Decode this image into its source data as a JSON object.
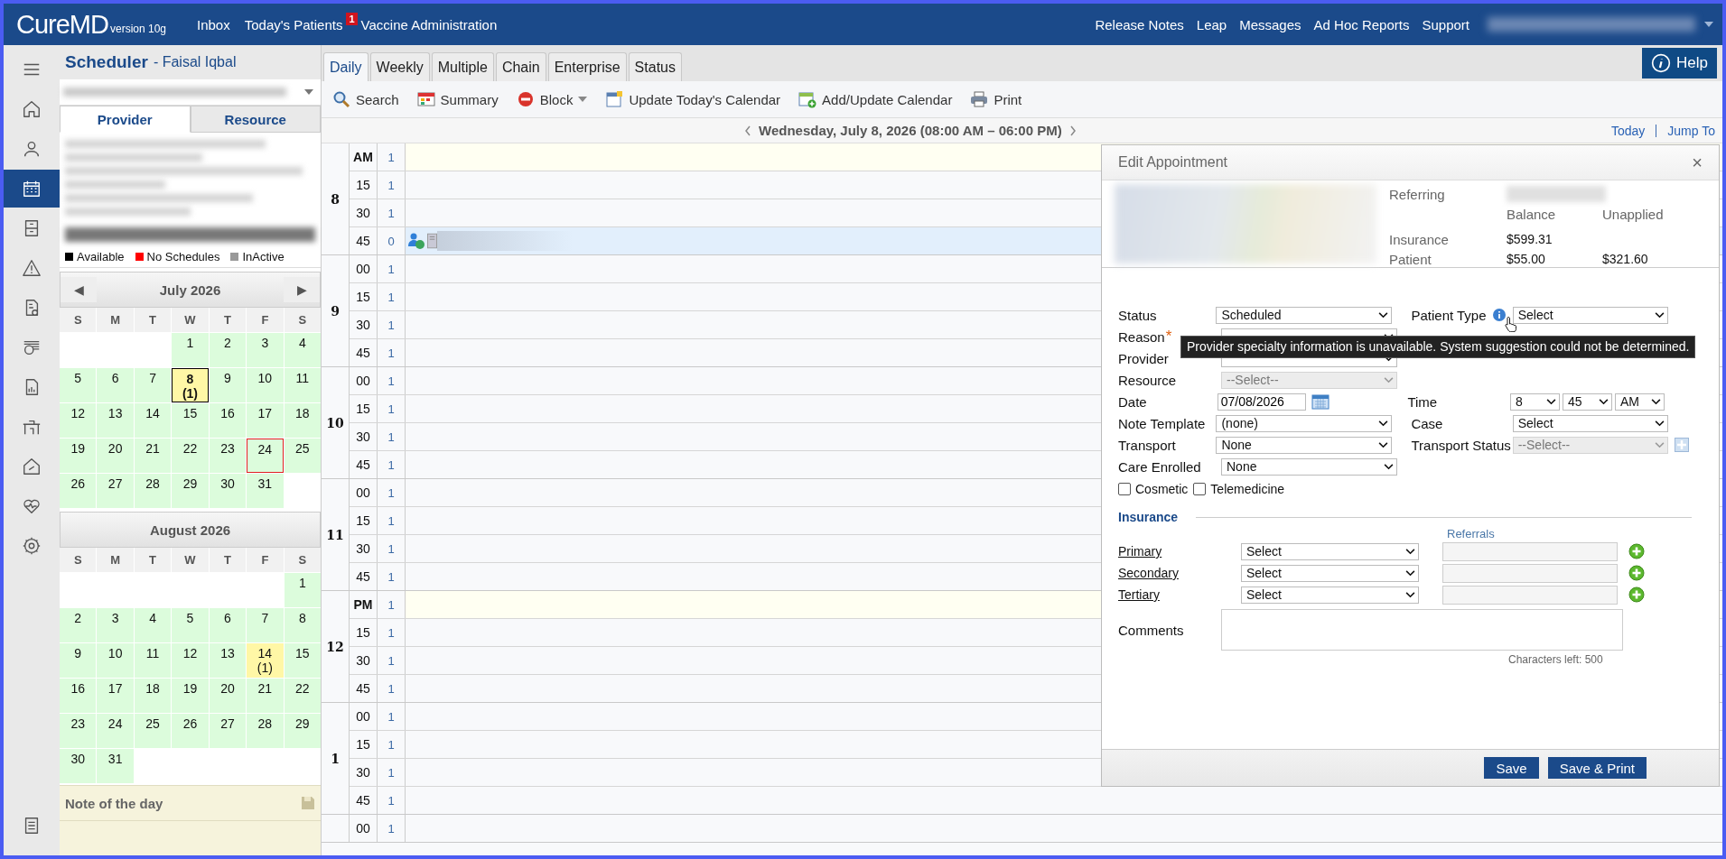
{
  "header": {
    "logo": "CureMD",
    "version": "version 10g",
    "nav": [
      {
        "label": "Inbox"
      },
      {
        "label": "Today's Patients",
        "badge": "1"
      },
      {
        "label": "Vaccine Administration"
      }
    ],
    "right_links": [
      "Release Notes",
      "Leap",
      "Messages",
      "Ad Hoc Reports",
      "Support"
    ]
  },
  "rail": [
    {
      "selected": false
    },
    {
      "selected": false
    },
    {
      "selected": false
    },
    {
      "selected": true
    },
    {
      "selected": false
    },
    {
      "selected": false
    },
    {
      "selected": false
    },
    {
      "selected": false
    },
    {
      "selected": false
    },
    {
      "selected": false
    },
    {
      "selected": false
    },
    {
      "selected": false
    },
    {
      "selected": false
    },
    {
      "selected": false
    }
  ],
  "scheduler": {
    "title": "Scheduler",
    "subtitle": "- Faisal Iqbal"
  },
  "sidebar_tabs": [
    {
      "label": "Provider",
      "selected": true
    },
    {
      "label": "Resource",
      "selected": false
    }
  ],
  "legend": [
    {
      "label": "Available",
      "color": "#000000"
    },
    {
      "label": "No Schedules",
      "color": "#ff0000"
    },
    {
      "label": "InActive",
      "color": "#999999"
    }
  ],
  "calendars": [
    {
      "title": "July 2026",
      "prev": "◀",
      "next": "▶",
      "weekdays": [
        "S",
        "M",
        "T",
        "W",
        "T",
        "F",
        "S"
      ],
      "days": [
        {
          "kind": "blank"
        },
        {
          "kind": "blank"
        },
        {
          "kind": "blank"
        },
        {
          "kind": "day",
          "label": "1",
          "selected": false,
          "today": false
        },
        {
          "kind": "day",
          "label": "2",
          "selected": false,
          "today": false
        },
        {
          "kind": "day",
          "label": "3",
          "selected": false,
          "today": false
        },
        {
          "kind": "day",
          "label": "4",
          "selected": false,
          "today": false
        },
        {
          "kind": "day",
          "label": "5",
          "selected": false,
          "today": false
        },
        {
          "kind": "day",
          "label": "6",
          "selected": false,
          "today": false
        },
        {
          "kind": "day",
          "label": "7",
          "selected": false,
          "today": false
        },
        {
          "kind": "day",
          "label": "8",
          "count": "(1)",
          "selected": true,
          "today": false
        },
        {
          "kind": "day",
          "label": "9",
          "selected": false,
          "today": false
        },
        {
          "kind": "day",
          "label": "10",
          "selected": false,
          "today": false
        },
        {
          "kind": "day",
          "label": "11",
          "selected": false,
          "today": false
        },
        {
          "kind": "day",
          "label": "12",
          "selected": false,
          "today": false
        },
        {
          "kind": "day",
          "label": "13",
          "selected": false,
          "today": false
        },
        {
          "kind": "day",
          "label": "14",
          "selected": false,
          "today": false
        },
        {
          "kind": "day",
          "label": "15",
          "selected": false,
          "today": false
        },
        {
          "kind": "day",
          "label": "16",
          "selected": false,
          "today": false
        },
        {
          "kind": "day",
          "label": "17",
          "selected": false,
          "today": false
        },
        {
          "kind": "day",
          "label": "18",
          "selected": false,
          "today": false
        },
        {
          "kind": "day",
          "label": "19",
          "selected": false,
          "today": false
        },
        {
          "kind": "day",
          "label": "20",
          "selected": false,
          "today": false
        },
        {
          "kind": "day",
          "label": "21",
          "selected": false,
          "today": false
        },
        {
          "kind": "day",
          "label": "22",
          "selected": false,
          "today": false
        },
        {
          "kind": "day",
          "label": "23",
          "selected": false,
          "today": false
        },
        {
          "kind": "day",
          "label": "24",
          "selected": false,
          "today": true
        },
        {
          "kind": "day",
          "label": "25",
          "selected": false,
          "today": false
        },
        {
          "kind": "day",
          "label": "26",
          "selected": false,
          "today": false
        },
        {
          "kind": "day",
          "label": "27",
          "selected": false,
          "today": false
        },
        {
          "kind": "day",
          "label": "28",
          "selected": false,
          "today": false
        },
        {
          "kind": "day",
          "label": "29",
          "selected": false,
          "today": false
        },
        {
          "kind": "day",
          "label": "30",
          "selected": false,
          "today": false
        },
        {
          "kind": "day",
          "label": "31",
          "selected": false,
          "today": false
        },
        {
          "kind": "blank"
        }
      ]
    },
    {
      "title": "August 2026",
      "weekdays": [
        "S",
        "M",
        "T",
        "W",
        "T",
        "F",
        "S"
      ],
      "days": [
        {
          "kind": "blank"
        },
        {
          "kind": "blank"
        },
        {
          "kind": "blank"
        },
        {
          "kind": "blank"
        },
        {
          "kind": "blank"
        },
        {
          "kind": "blank"
        },
        {
          "kind": "day",
          "label": "1",
          "selected": false,
          "today": false
        },
        {
          "kind": "day",
          "label": "2",
          "selected": false,
          "today": false
        },
        {
          "kind": "day",
          "label": "3",
          "selected": false,
          "today": false
        },
        {
          "kind": "day",
          "label": "4",
          "selected": false,
          "today": false
        },
        {
          "kind": "day",
          "label": "5",
          "selected": false,
          "today": false
        },
        {
          "kind": "day",
          "label": "6",
          "selected": false,
          "today": false
        },
        {
          "kind": "day",
          "label": "7",
          "selected": false,
          "today": false
        },
        {
          "kind": "day",
          "label": "8",
          "selected": false,
          "today": false
        },
        {
          "kind": "day",
          "label": "9",
          "selected": false,
          "today": false
        },
        {
          "kind": "day",
          "label": "10",
          "selected": false,
          "today": false
        },
        {
          "kind": "day",
          "label": "11",
          "selected": false,
          "today": false
        },
        {
          "kind": "day",
          "label": "12",
          "selected": false,
          "today": false
        },
        {
          "kind": "day",
          "label": "13",
          "selected": false,
          "today": false
        },
        {
          "kind": "day",
          "label": "14",
          "count": "(1)",
          "selected": false,
          "today": false
        },
        {
          "kind": "day",
          "label": "15",
          "selected": false,
          "today": false
        },
        {
          "kind": "day",
          "label": "16",
          "selected": false,
          "today": false
        },
        {
          "kind": "day",
          "label": "17",
          "selected": false,
          "today": false
        },
        {
          "kind": "day",
          "label": "18",
          "selected": false,
          "today": false
        },
        {
          "kind": "day",
          "label": "19",
          "selected": false,
          "today": false
        },
        {
          "kind": "day",
          "label": "20",
          "selected": false,
          "today": false
        },
        {
          "kind": "day",
          "label": "21",
          "selected": false,
          "today": false
        },
        {
          "kind": "day",
          "label": "22",
          "selected": false,
          "today": false
        },
        {
          "kind": "day",
          "label": "23",
          "selected": false,
          "today": false
        },
        {
          "kind": "day",
          "label": "24",
          "selected": false,
          "today": false
        },
        {
          "kind": "day",
          "label": "25",
          "selected": false,
          "today": false
        },
        {
          "kind": "day",
          "label": "26",
          "selected": false,
          "today": false
        },
        {
          "kind": "day",
          "label": "27",
          "selected": false,
          "today": false
        },
        {
          "kind": "day",
          "label": "28",
          "selected": false,
          "today": false
        },
        {
          "kind": "day",
          "label": "29",
          "selected": false,
          "today": false
        },
        {
          "kind": "day",
          "label": "30",
          "selected": false,
          "today": false
        },
        {
          "kind": "day",
          "label": "31",
          "selected": false,
          "today": false
        },
        {
          "kind": "blank"
        },
        {
          "kind": "blank"
        },
        {
          "kind": "blank"
        },
        {
          "kind": "blank"
        },
        {
          "kind": "blank"
        }
      ]
    }
  ],
  "note": {
    "title": "Note of the day"
  },
  "tabs": [
    {
      "label": "Daily",
      "selected": true
    },
    {
      "label": "Weekly",
      "selected": false
    },
    {
      "label": "Multiple",
      "selected": false
    },
    {
      "label": "Chain",
      "selected": false
    },
    {
      "label": "Enterprise",
      "selected": false
    },
    {
      "label": "Status",
      "selected": false
    }
  ],
  "help": "Help",
  "toolbar": [
    {
      "label": "Search",
      "dropdown": false
    },
    {
      "label": "Summary",
      "dropdown": false
    },
    {
      "label": "Block",
      "dropdown": true
    },
    {
      "label": "Update Today's Calendar",
      "dropdown": false
    },
    {
      "label": "Add/Update Calendar",
      "dropdown": false
    },
    {
      "label": "Print",
      "dropdown": false
    }
  ],
  "date_bar": {
    "title": "Wednesday, July 8, 2026 (08:00 AM – 06:00 PM)",
    "links": [
      "Today",
      "Jump To"
    ]
  },
  "schedule": [
    {
      "hour": "8",
      "slots": [
        {
          "minute": "AM",
          "count": "1",
          "kind": "period"
        },
        {
          "minute": "15",
          "count": "1",
          "kind": "open"
        },
        {
          "minute": "30",
          "count": "1",
          "kind": "open"
        },
        {
          "minute": "45",
          "count": "0",
          "kind": "booked"
        }
      ]
    },
    {
      "hour": "9",
      "slots": [
        {
          "minute": "00",
          "count": "1",
          "kind": "open"
        },
        {
          "minute": "15",
          "count": "1",
          "kind": "open"
        },
        {
          "minute": "30",
          "count": "1",
          "kind": "open"
        },
        {
          "minute": "45",
          "count": "1",
          "kind": "open"
        }
      ]
    },
    {
      "hour": "10",
      "slots": [
        {
          "minute": "00",
          "count": "1",
          "kind": "open"
        },
        {
          "minute": "15",
          "count": "1",
          "kind": "open"
        },
        {
          "minute": "30",
          "count": "1",
          "kind": "open"
        },
        {
          "minute": "45",
          "count": "1",
          "kind": "open"
        }
      ]
    },
    {
      "hour": "11",
      "slots": [
        {
          "minute": "00",
          "count": "1",
          "kind": "open"
        },
        {
          "minute": "15",
          "count": "1",
          "kind": "open"
        },
        {
          "minute": "30",
          "count": "1",
          "kind": "open"
        },
        {
          "minute": "45",
          "count": "1",
          "kind": "open"
        }
      ]
    },
    {
      "hour": "12",
      "slots": [
        {
          "minute": "PM",
          "count": "1",
          "kind": "period"
        },
        {
          "minute": "15",
          "count": "1",
          "kind": "open"
        },
        {
          "minute": "30",
          "count": "1",
          "kind": "open"
        },
        {
          "minute": "45",
          "count": "1",
          "kind": "open"
        }
      ]
    },
    {
      "hour": "1",
      "slots": [
        {
          "minute": "00",
          "count": "1",
          "kind": "open"
        },
        {
          "minute": "15",
          "count": "1",
          "kind": "open"
        },
        {
          "minute": "30",
          "count": "1",
          "kind": "open"
        },
        {
          "minute": "45",
          "count": "1",
          "kind": "open"
        }
      ]
    },
    {
      "slots": [
        {
          "minute": "00",
          "count": "1",
          "kind": "open"
        }
      ]
    }
  ],
  "edit_appointment": {
    "title": "Edit Appointment",
    "close": "×",
    "summary": {
      "referring": "Referring",
      "columns": [
        "Balance",
        "Unapplied"
      ],
      "rows": [
        {
          "label": "Insurance",
          "values": [
            "$599.31"
          ]
        },
        {
          "label": "Patient",
          "values": [
            "$55.00",
            "$321.60"
          ]
        }
      ]
    },
    "rows": [
      {
        "left": {
          "label": "Status",
          "kind": "select",
          "value": "Scheduled",
          "disabled": false
        },
        "right": {
          "label": "Patient Type",
          "kind": "select",
          "value": "Select",
          "disabled": false,
          "tooltip": "Provider specialty information is unavailable. System suggestion could not be determined."
        }
      },
      {
        "left": {
          "label": "Reason",
          "required_mark": "*",
          "kind": "select",
          "disabled": false
        }
      },
      {
        "left": {
          "label": "Provider",
          "kind": "select",
          "disabled": false
        }
      },
      {
        "left": {
          "label": "Resource",
          "kind": "select",
          "value": "--Select--",
          "disabled": true
        }
      },
      {
        "left": {
          "label": "Date",
          "kind": "date",
          "value": "07/08/2026"
        },
        "right": {
          "label": "Time",
          "kind": "time",
          "parts": [
            "8",
            "45",
            "AM"
          ]
        }
      },
      {
        "left": {
          "label": "Note Template",
          "kind": "select",
          "value": "(none)",
          "disabled": false
        },
        "right": {
          "label": "Case",
          "kind": "select",
          "value": "Select",
          "disabled": false
        }
      },
      {
        "left": {
          "label": "Transport",
          "kind": "select",
          "value": "None",
          "disabled": false
        },
        "right": {
          "label": "Transport Status",
          "kind": "select",
          "value": "--Select--",
          "disabled": true,
          "add_button": true
        }
      },
      {
        "left": {
          "label": "Care Enrolled",
          "kind": "select",
          "value": "None",
          "disabled": false
        }
      }
    ],
    "checkboxes": [
      {
        "label": "Cosmetic",
        "checked": false
      },
      {
        "label": "Telemedicine",
        "checked": false
      }
    ],
    "insurance": {
      "title": "Insurance",
      "referrals": "Referrals",
      "rows": [
        {
          "label": "Primary",
          "value": "Select"
        },
        {
          "label": "Secondary",
          "value": "Select"
        },
        {
          "label": "Tertiary",
          "value": "Select"
        }
      ]
    },
    "comments": {
      "label": "Comments",
      "chars_left": "Characters left: 500"
    },
    "buttons": [
      "Save",
      "Save & Print"
    ]
  }
}
